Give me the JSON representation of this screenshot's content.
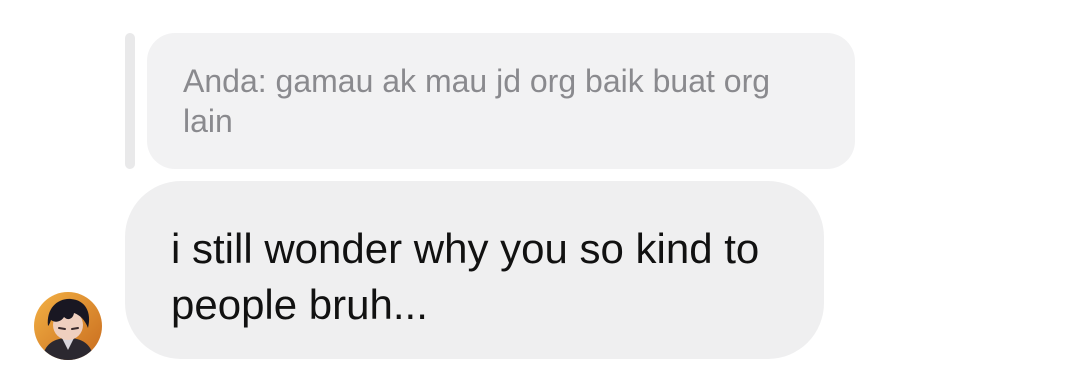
{
  "quoted_reply": {
    "text": "Anda: gamau ak mau jd org baik buat org lain"
  },
  "message": {
    "text": "i still wonder why you so kind to people bruh..."
  },
  "sender": {
    "avatar_icon": "user-avatar"
  },
  "colors": {
    "background": "#ffffff",
    "reply_bubble": "#f2f2f3",
    "reply_bar": "#e9e9ea",
    "message_bubble": "#efeff0",
    "reply_text": "#8a8a8e",
    "message_text": "#111111"
  }
}
